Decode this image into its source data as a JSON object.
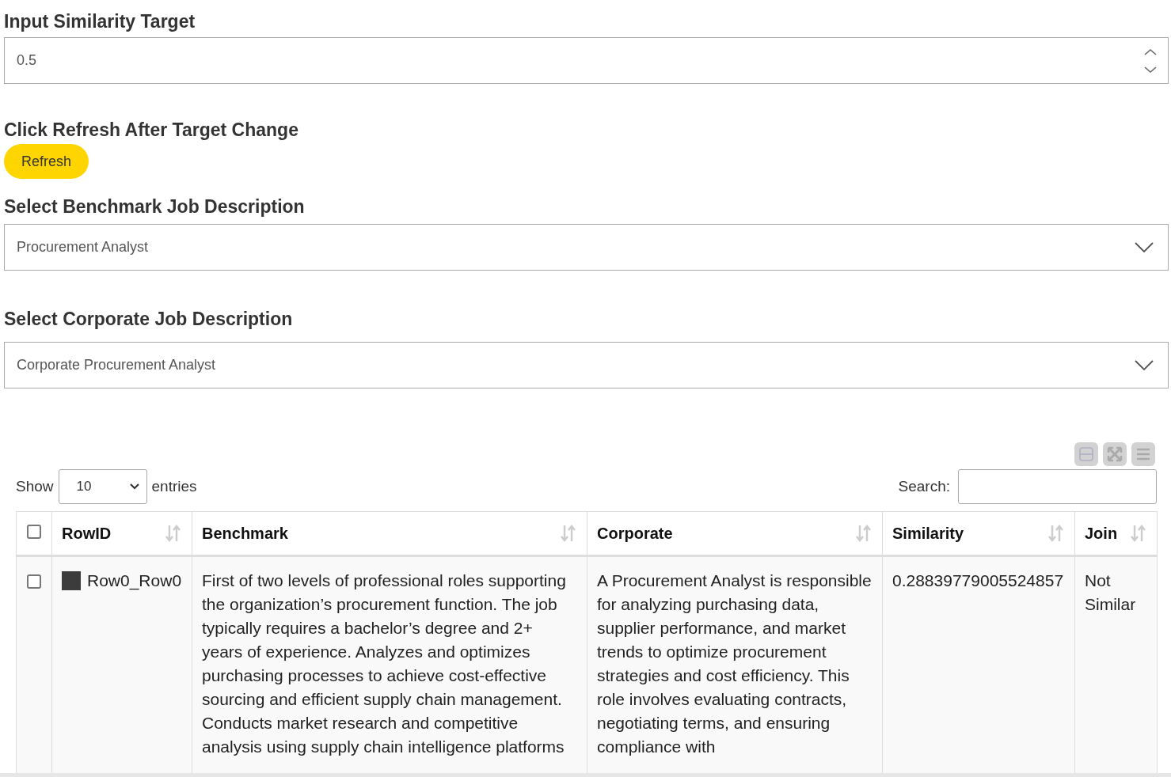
{
  "target": {
    "label": "Input Similarity Target",
    "value": "0.5"
  },
  "refresh": {
    "label": "Click Refresh After Target Change",
    "button": "Refresh"
  },
  "benchmark_select": {
    "label": "Select Benchmark Job Description",
    "value": "Procurement Analyst"
  },
  "corporate_select": {
    "label": "Select Corporate Job Description",
    "value": "Corporate Procurement Analyst"
  },
  "table": {
    "length": {
      "prefix": "Show",
      "value": "10",
      "suffix": "entries"
    },
    "search": {
      "label": "Search:"
    },
    "select_all": {
      "checked": false
    },
    "columns": [
      "RowID",
      "Benchmark",
      "Corporate",
      "Similarity",
      "Join"
    ],
    "rows": [
      {
        "checked": false,
        "color": "#3c3c3c",
        "cells": [
          "Row0_Row0",
          "First of two levels of professional roles supporting the organization’s procurement function. The job typically requires a bachelor’s degree and 2+ years of experience. Analyzes and optimizes purchasing processes to achieve cost-effective sourcing and efficient supply chain management. Conducts market research and competitive analysis using supply chain intelligence platforms",
          "A Procurement Analyst is responsible for analyzing purchasing data, supplier performance, and market trends to optimize procurement strategies and cost efficiency. This role involves evaluating contracts, negotiating terms, and ensuring compliance with",
          "0.28839779005524857",
          "Not Similar"
        ]
      }
    ]
  }
}
